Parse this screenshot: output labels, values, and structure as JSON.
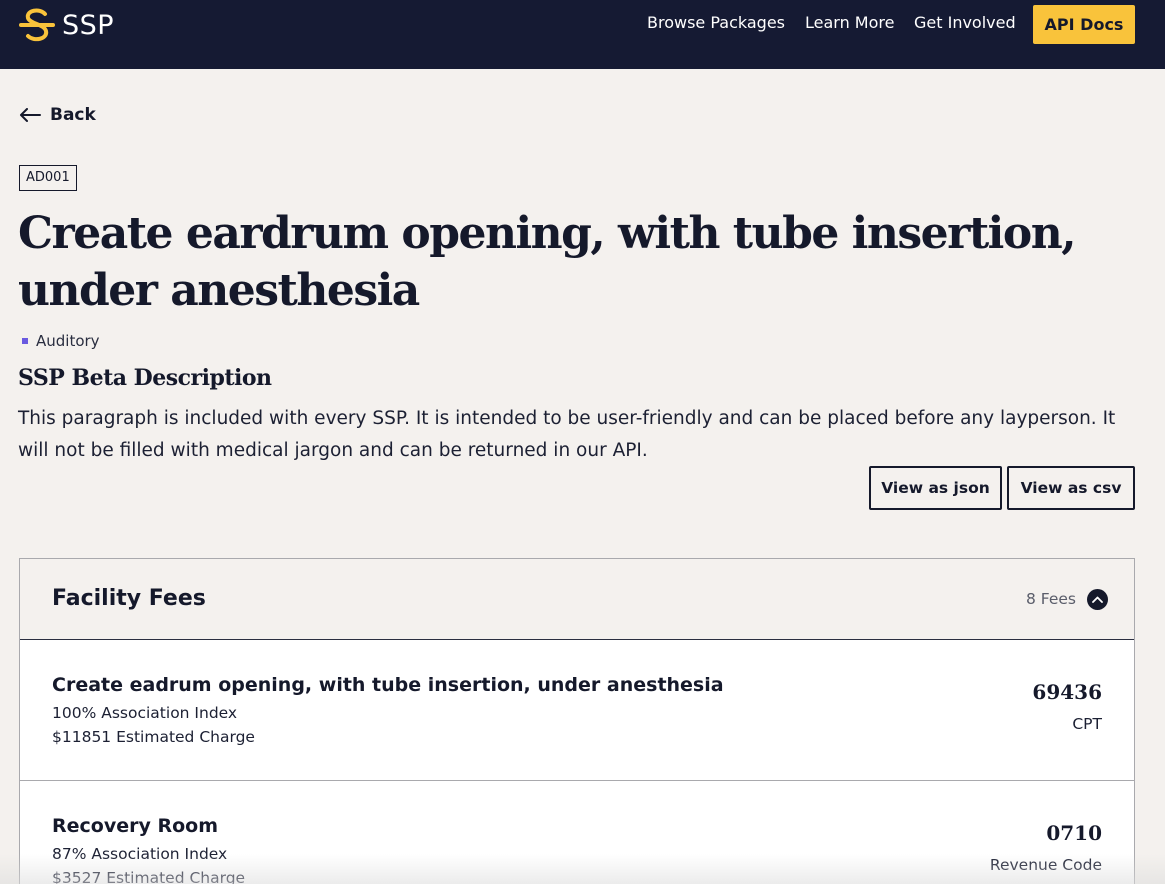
{
  "header": {
    "logo_text": "SSP",
    "nav": [
      "Browse Packages",
      "Learn More",
      "Get Involved"
    ],
    "cta_label": "API Docs",
    "colors": {
      "background": "#151a33",
      "accent": "#f9c33b"
    }
  },
  "back_label": "Back",
  "code_tag": "AD001",
  "title": "Create eardrum opening, with tube insertion, under anesthesia",
  "category": "Auditory",
  "description": {
    "heading": "SSP Beta Description",
    "text": "This paragraph is included with every SSP. It is intended to be user-friendly and can be placed before any layperson. It will not be filled with medical jargon and can be returned in our API."
  },
  "actions": {
    "json_label": "View as json",
    "csv_label": "View as csv"
  },
  "facility_fees": {
    "heading": "Facility Fees",
    "count_label": "8 Fees",
    "expanded": true,
    "items": [
      {
        "name": "Create eadrum opening, with tube insertion, under anesthesia",
        "association": "100% Association Index",
        "charge": "$11851 Estimated Charge",
        "code": "69436",
        "code_type": "CPT"
      },
      {
        "name": "Recovery Room",
        "association": "87% Association Index",
        "charge": "$3527 Estimated Charge",
        "code": "0710",
        "code_type": "Revenue Code"
      }
    ]
  }
}
